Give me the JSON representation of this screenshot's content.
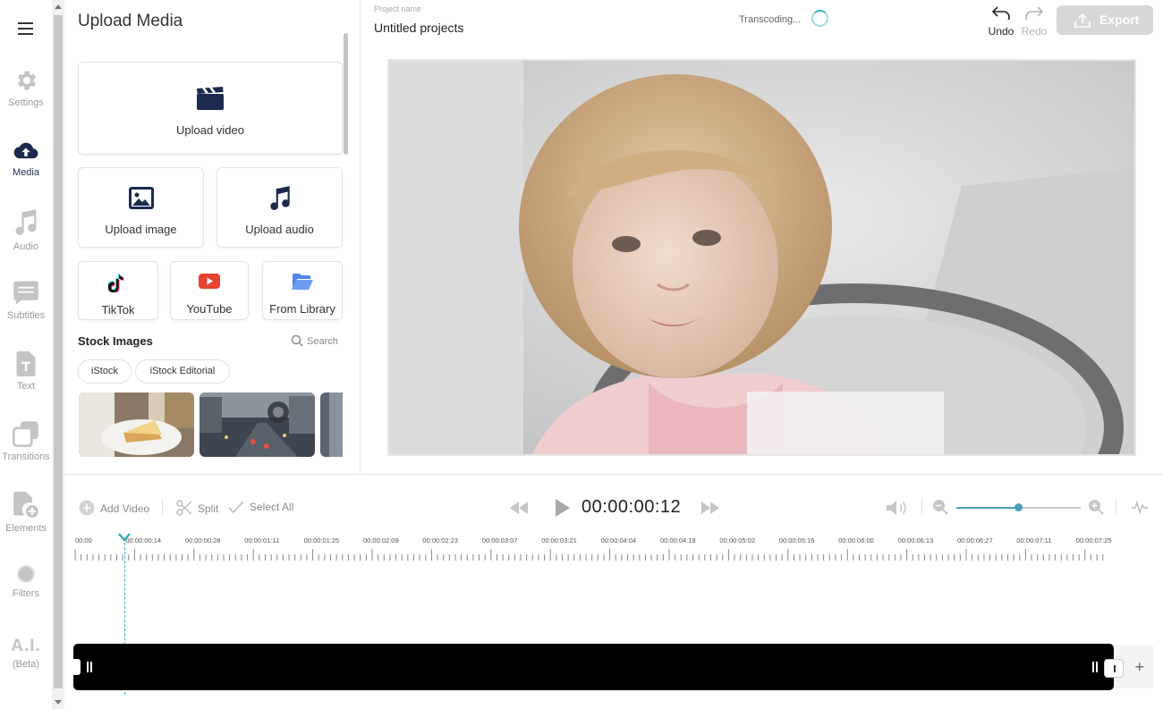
{
  "nav": {
    "items": [
      {
        "id": "settings",
        "label": "Settings",
        "icon": "gear-icon"
      },
      {
        "id": "media",
        "label": "Media",
        "icon": "cloud-upload-icon",
        "active": true
      },
      {
        "id": "audio",
        "label": "Audio",
        "icon": "music-note-icon"
      },
      {
        "id": "subtitles",
        "label": "Subtitles",
        "icon": "subtitles-icon"
      },
      {
        "id": "text",
        "label": "Text",
        "icon": "text-document-icon"
      },
      {
        "id": "transitions",
        "label": "Transitions",
        "icon": "transitions-icon"
      },
      {
        "id": "elements",
        "label": "Elements",
        "icon": "elements-icon"
      },
      {
        "id": "filters",
        "label": "Filters",
        "icon": "filters-icon"
      },
      {
        "id": "ai",
        "label": "(Beta)",
        "mark": "A.I."
      }
    ]
  },
  "panel": {
    "title": "Upload Media",
    "upload_video": "Upload video",
    "upload_image": "Upload image",
    "upload_audio": "Upload audio",
    "tiktok": "TikTok",
    "youtube": "YouTube",
    "library": "From Library",
    "stock_title": "Stock Images",
    "search": "Search",
    "chips": [
      "iStock",
      "iStock Editorial"
    ]
  },
  "topbar": {
    "project_label": "Project name",
    "project_name": "Untitled projects",
    "status": "Transcoding...",
    "undo": "Undo",
    "redo": "Redo",
    "export": "Export"
  },
  "timeline": {
    "add_video": "Add Video",
    "split": "Split",
    "select_all": "Select All",
    "timecode": "00:00:00:12",
    "zoom_level": 0.5,
    "ruler_labels": [
      "00:00",
      "00:00:00:14",
      "00:00:00:28",
      "00:00:01:11",
      "00:00:01:25",
      "00:00:02:09",
      "00:00:02:23",
      "00:00:03:07",
      "00:00:03:21",
      "00:00:04:04",
      "00:00:04:18",
      "00:00:05:02",
      "00:00:05:16",
      "00:00:06:00",
      "00:00:06:13",
      "00:00:06:27",
      "00:00:07:11",
      "00:00:07:25"
    ],
    "add_track": "+"
  },
  "colors": {
    "accent": "#1b2a4e",
    "teal": "#2bb3b3",
    "export_disabled": "#d8d8d8"
  }
}
